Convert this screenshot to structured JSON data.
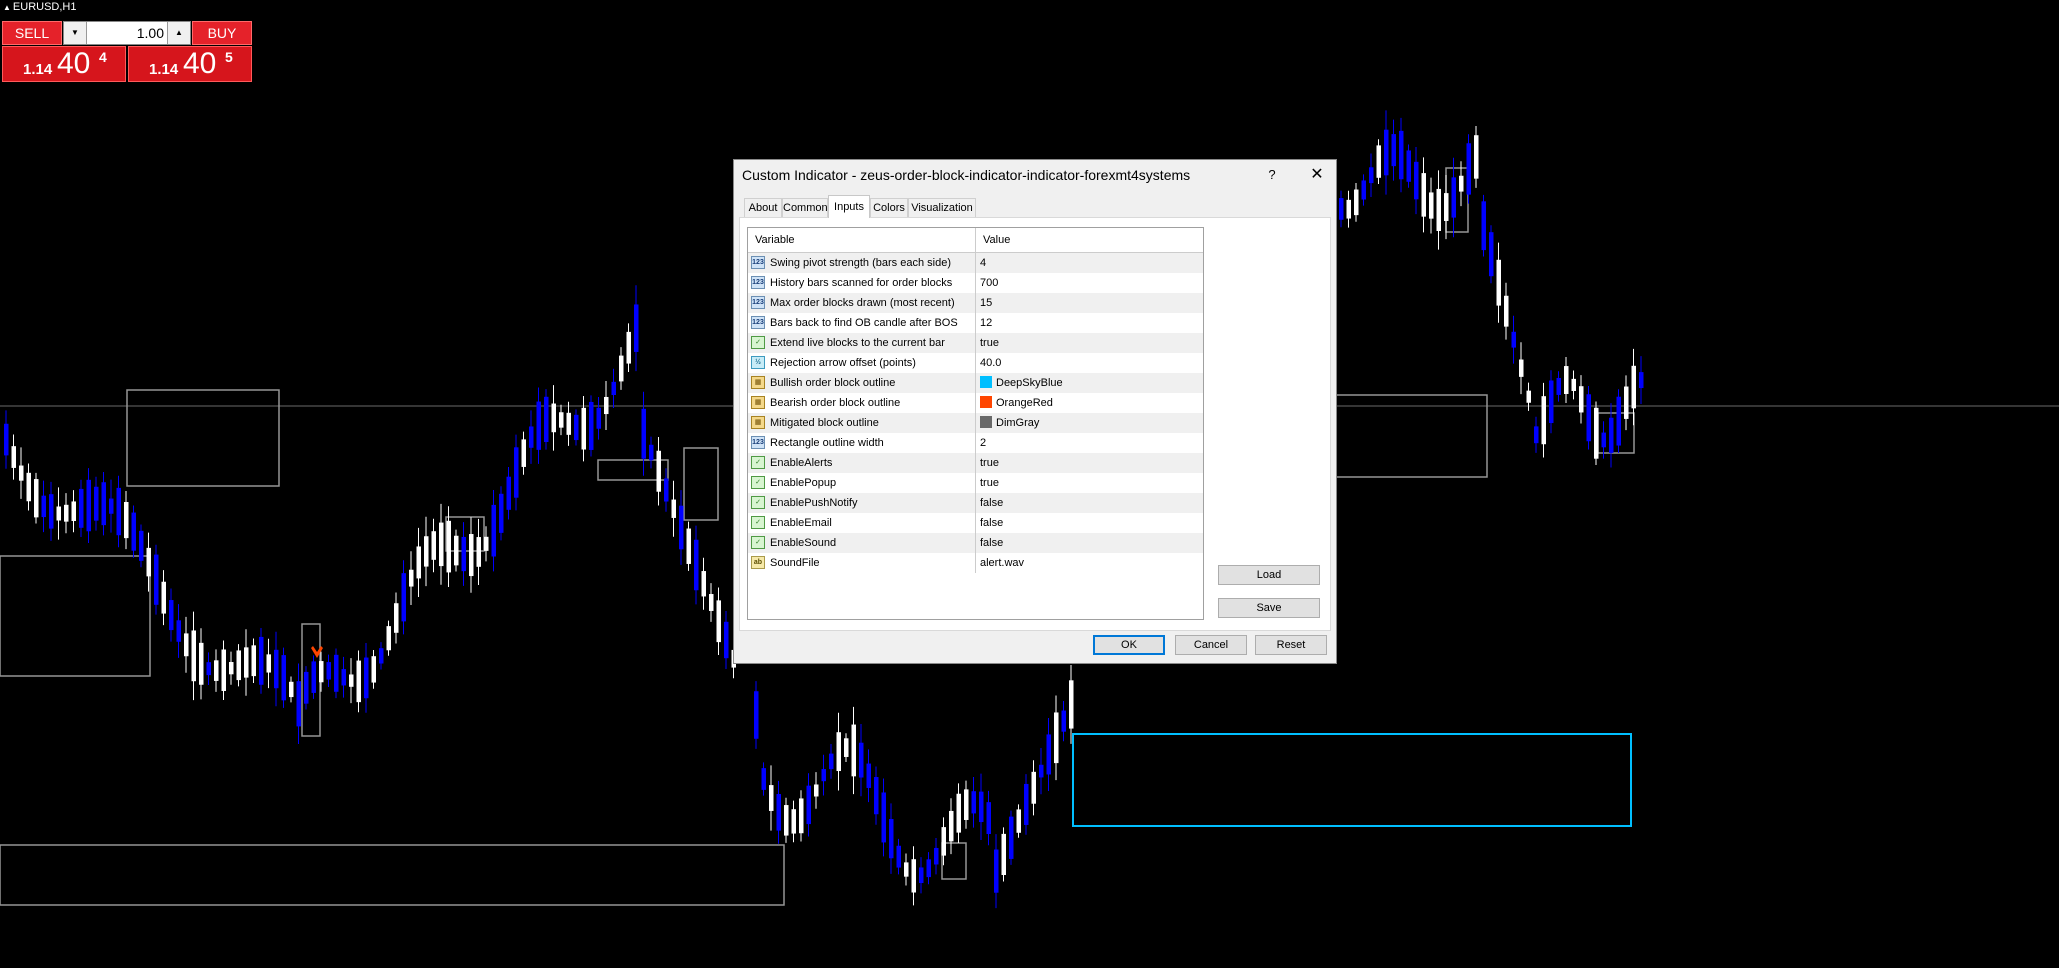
{
  "symbol": {
    "label": "EURUSD,H1"
  },
  "trade_panel": {
    "sell_label": "SELL",
    "buy_label": "BUY",
    "lot": "1.00",
    "bid": {
      "small": "1.14",
      "big": "40",
      "sup": "4"
    },
    "ask": {
      "small": "1.14",
      "big": "40",
      "sup": "5"
    }
  },
  "dialog": {
    "title": "Custom Indicator - zeus-order-block-indicator-indicator-forexmt4systems",
    "help": "?",
    "close": "✕",
    "tabs": [
      "About",
      "Common",
      "Inputs",
      "Colors",
      "Visualization"
    ],
    "active_tab": "Inputs",
    "grid": {
      "col_variable": "Variable",
      "col_value": "Value",
      "rows": [
        {
          "icon": "int-icon",
          "name": "Swing pivot strength (bars each side)",
          "value": "4"
        },
        {
          "icon": "int-icon",
          "name": "History bars scanned for order blocks",
          "value": "700"
        },
        {
          "icon": "int-icon",
          "name": "Max order blocks drawn (most recent)",
          "value": "15"
        },
        {
          "icon": "int-icon",
          "name": "Bars back to find OB candle after BOS",
          "value": "12"
        },
        {
          "icon": "bool-icon",
          "name": "Extend live blocks to the current bar",
          "value": "true"
        },
        {
          "icon": "double-icon",
          "name": "Rejection arrow offset (points)",
          "value": "40.0"
        },
        {
          "icon": "color-icon",
          "name": "Bullish order block outline",
          "value": "DeepSkyBlue",
          "swatch": "#00bfff"
        },
        {
          "icon": "color-icon",
          "name": "Bearish order block outline",
          "value": "OrangeRed",
          "swatch": "#ff4500"
        },
        {
          "icon": "color-icon",
          "name": "Mitigated block outline",
          "value": "DimGray",
          "swatch": "#696969"
        },
        {
          "icon": "int-icon",
          "name": "Rectangle outline width",
          "value": "2"
        },
        {
          "icon": "bool-icon",
          "name": "EnableAlerts",
          "value": "true"
        },
        {
          "icon": "bool-icon",
          "name": "EnablePopup",
          "value": "true"
        },
        {
          "icon": "bool-icon",
          "name": "EnablePushNotify",
          "value": "false"
        },
        {
          "icon": "bool-icon",
          "name": "EnableEmail",
          "value": "false"
        },
        {
          "icon": "bool-icon",
          "name": "EnableSound",
          "value": "false"
        },
        {
          "icon": "string-icon",
          "name": "SoundFile",
          "value": "alert.wav"
        }
      ]
    },
    "buttons": {
      "load": "Load",
      "save": "Save",
      "ok": "OK",
      "cancel": "Cancel",
      "reset": "Reset"
    }
  },
  "colors": {
    "chart_bg": "#000000",
    "bull_candle": "#ffffff",
    "bear_candle": "#0000ff",
    "bull_block": "#00bfff",
    "block_gray": "#969696",
    "arrow": "#ff4500",
    "sell_red": "#e5222a"
  }
}
